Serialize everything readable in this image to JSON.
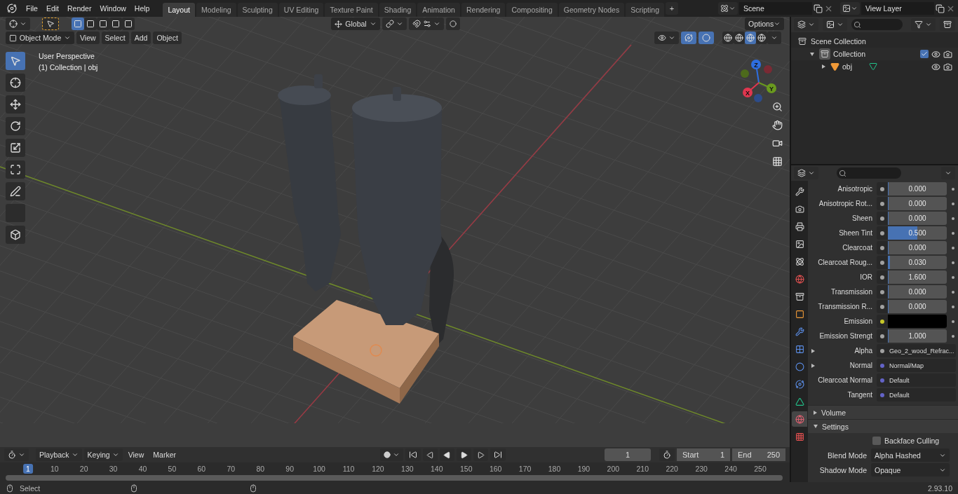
{
  "menu": [
    "File",
    "Edit",
    "Render",
    "Window",
    "Help"
  ],
  "workspaces": [
    {
      "label": "Layout",
      "selected": true
    },
    {
      "label": "Modeling",
      "selected": false
    },
    {
      "label": "Sculpting",
      "selected": false
    },
    {
      "label": "UV Editing",
      "selected": false
    },
    {
      "label": "Texture Paint",
      "selected": false
    },
    {
      "label": "Shading",
      "selected": false
    },
    {
      "label": "Animation",
      "selected": false
    },
    {
      "label": "Rendering",
      "selected": false
    },
    {
      "label": "Compositing",
      "selected": false
    },
    {
      "label": "Geometry Nodes",
      "selected": false
    },
    {
      "label": "Scripting",
      "selected": false
    }
  ],
  "add_workspace": "+",
  "scene": "Scene",
  "view_layer": "View Layer",
  "tool_header": {
    "orientation": "Global",
    "options": "Options",
    "select_modes": [
      {
        "selected": true
      },
      {
        "selected": false
      },
      {
        "selected": false
      },
      {
        "selected": false
      },
      {
        "selected": false
      }
    ]
  },
  "viewport_header": {
    "mode": "Object Mode",
    "menus": [
      "View",
      "Select",
      "Add",
      "Object"
    ],
    "shading": [
      {
        "selected": false
      },
      {
        "selected": false
      },
      {
        "selected": true
      },
      {
        "selected": false
      }
    ]
  },
  "viewport": {
    "title": "User Perspective",
    "subtitle": "(1) Collection | obj"
  },
  "tools": [
    {
      "kind": "select",
      "selected": true
    },
    {
      "kind": "cursor",
      "selected": false
    },
    {
      "kind": "move",
      "selected": false
    },
    {
      "kind": "rotate",
      "selected": false
    },
    {
      "kind": "scale",
      "selected": false
    },
    {
      "kind": "transform",
      "selected": false
    },
    {
      "kind": "annotate",
      "selected": false
    },
    {
      "kind": "measure",
      "selected": false
    },
    {
      "kind": "add-cube",
      "selected": false
    }
  ],
  "gizmo_axes": [
    {
      "label": "Z",
      "color": "#2e6ee0"
    },
    {
      "label": "Y",
      "color": "#6a9a1e"
    },
    {
      "label": "X",
      "color": "#e0364f"
    }
  ],
  "outliner": {
    "tree": [
      {
        "label": "Scene Collection",
        "kind": "scene",
        "children": [
          {
            "label": "Collection",
            "kind": "collection",
            "expanded": true,
            "checked": true,
            "children": [
              {
                "label": "obj",
                "kind": "mesh",
                "expanded": false
              }
            ]
          }
        ]
      }
    ]
  },
  "properties": {
    "tabs": [
      {
        "kind": "tool",
        "selected": false
      },
      {
        "kind": "render",
        "selected": false
      },
      {
        "kind": "output",
        "selected": false
      },
      {
        "kind": "view-layer",
        "selected": false
      },
      {
        "kind": "scene",
        "selected": false
      },
      {
        "kind": "world",
        "selected": false
      },
      {
        "kind": "collection",
        "selected": false
      },
      {
        "kind": "object",
        "selected": false
      },
      {
        "kind": "modifiers",
        "selected": false
      },
      {
        "kind": "particles",
        "selected": false
      },
      {
        "kind": "physics",
        "selected": false
      },
      {
        "kind": "constraints",
        "selected": false
      },
      {
        "kind": "data",
        "selected": false
      },
      {
        "kind": "material",
        "selected": true
      },
      {
        "kind": "texture",
        "selected": false
      }
    ],
    "rows": [
      {
        "kind": "slider",
        "label": "Anisotropic",
        "value": "0.000",
        "level": 0
      },
      {
        "kind": "slider",
        "label": "Anisotropic Rot...",
        "value": "0.000",
        "level": 0
      },
      {
        "kind": "slider",
        "label": "Sheen",
        "value": "0.000",
        "level": 0
      },
      {
        "kind": "slider",
        "label": "Sheen Tint",
        "value": "0.500",
        "level": 0.5
      },
      {
        "kind": "slider",
        "label": "Clearcoat",
        "value": "0.000",
        "level": 0
      },
      {
        "kind": "slider",
        "label": "Clearcoat Roug...",
        "value": "0.030",
        "level": 0.03
      },
      {
        "kind": "slider",
        "label": "IOR",
        "value": "1.600",
        "level": 0
      },
      {
        "kind": "slider",
        "label": "Transmission",
        "value": "0.000",
        "level": 0
      },
      {
        "kind": "slider",
        "label": "Transmission R...",
        "value": "0.000",
        "level": 0
      },
      {
        "kind": "color",
        "label": "Emission",
        "color": "#000000"
      },
      {
        "kind": "slider",
        "label": "Emission Strengt",
        "value": "1.000",
        "level": 0
      },
      {
        "kind": "link",
        "label": "Alpha",
        "value": "Geo_2_wood_Refrac...",
        "expanded": false
      },
      {
        "kind": "vector",
        "label": "Normal",
        "value": "Normal/Map",
        "expanded": false
      },
      {
        "kind": "vector",
        "label": "Clearcoat Normal",
        "value": "Default"
      },
      {
        "kind": "vector",
        "label": "Tangent",
        "value": "Default"
      }
    ],
    "panels": [
      {
        "label": "Volume",
        "expanded": false
      },
      {
        "label": "Settings",
        "expanded": true
      }
    ],
    "backface_culling": {
      "label": "Backface Culling",
      "checked": false
    },
    "settings": [
      {
        "label": "Blend Mode",
        "value": "Alpha Hashed"
      },
      {
        "label": "Shadow Mode",
        "value": "Opaque"
      }
    ]
  },
  "timeline": {
    "menus": [
      "Playback",
      "Keying",
      "View",
      "Marker"
    ],
    "current_frame": "1",
    "start_label": "Start",
    "start": "1",
    "end_label": "End",
    "end": "250",
    "ticks": [
      "1",
      "10",
      "20",
      "30",
      "40",
      "50",
      "60",
      "70",
      "80",
      "90",
      "100",
      "110",
      "120",
      "130",
      "140",
      "150",
      "160",
      "170",
      "180",
      "190",
      "200",
      "210",
      "220",
      "230",
      "240",
      "250"
    ]
  },
  "status_bar": {
    "action": "Select",
    "version": "2.93.10"
  }
}
